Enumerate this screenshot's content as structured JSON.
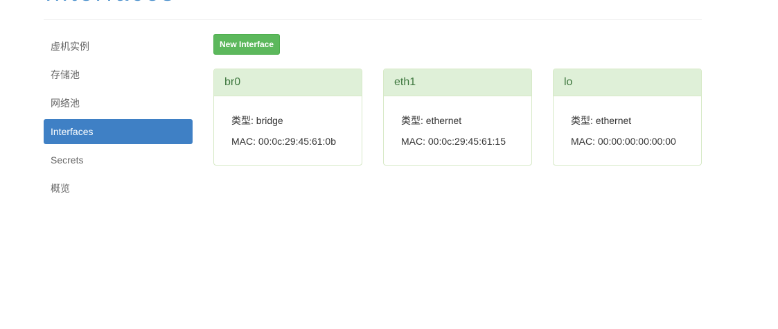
{
  "header": {
    "title": "Interfaces"
  },
  "sidebar": {
    "items": [
      {
        "label": "虚机实例",
        "active": false
      },
      {
        "label": "存储池",
        "active": false
      },
      {
        "label": "网络池",
        "active": false
      },
      {
        "label": "Interfaces",
        "active": true
      },
      {
        "label": "Secrets",
        "active": false
      },
      {
        "label": "概览",
        "active": false
      }
    ]
  },
  "toolbar": {
    "new_interface_label": "New Interface"
  },
  "interfaces": [
    {
      "name": "br0",
      "type_label": "类型:",
      "type": "bridge",
      "mac_label": "MAC:",
      "mac": "00:0c:29:45:61:0b"
    },
    {
      "name": "eth1",
      "type_label": "类型:",
      "type": "ethernet",
      "mac_label": "MAC:",
      "mac": "00:0c:29:45:61:15"
    },
    {
      "name": "lo",
      "type_label": "类型:",
      "type": "ethernet",
      "mac_label": "MAC:",
      "mac": "00:00:00:00:00:00"
    }
  ],
  "colors": {
    "accent": "#3f80c5",
    "success_button": "#5cb85c",
    "panel_header_bg": "#dff0d8",
    "panel_header_text": "#3c763d"
  }
}
